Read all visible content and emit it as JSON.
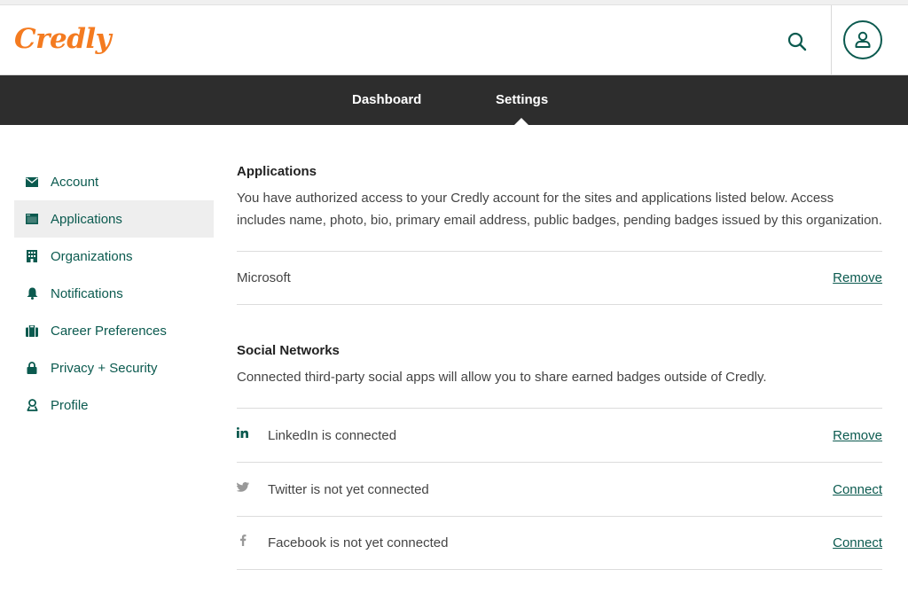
{
  "header": {
    "logo": "Credly",
    "search_icon": "search-icon",
    "avatar_icon": "user-icon"
  },
  "nav": {
    "dashboard": "Dashboard",
    "settings": "Settings"
  },
  "sidebar": {
    "items": [
      {
        "label": "Account",
        "icon": "envelope-icon"
      },
      {
        "label": "Applications",
        "icon": "browser-window-icon"
      },
      {
        "label": "Organizations",
        "icon": "building-icon"
      },
      {
        "label": "Notifications",
        "icon": "bell-icon"
      },
      {
        "label": "Career Preferences",
        "icon": "briefcase-icon"
      },
      {
        "label": "Privacy + Security",
        "icon": "lock-icon"
      },
      {
        "label": "Profile",
        "icon": "badge-person-icon"
      }
    ]
  },
  "applications": {
    "title": "Applications",
    "description": "You have authorized access to your Credly account for the sites and applications listed below. Access includes name, photo, bio, primary email address, public badges, pending badges issued by this organization.",
    "items": [
      {
        "name": "Microsoft",
        "action": "Remove"
      }
    ]
  },
  "social": {
    "title": "Social Networks",
    "description": "Connected third-party social apps will allow you to share earned badges outside of Credly.",
    "items": [
      {
        "label": "LinkedIn is connected",
        "action": "Remove",
        "icon": "linkedin-icon"
      },
      {
        "label": "Twitter is not yet connected",
        "action": "Connect",
        "icon": "twitter-icon"
      },
      {
        "label": "Facebook is not yet connected",
        "action": "Connect",
        "icon": "facebook-icon"
      }
    ]
  },
  "colors": {
    "brand_orange": "#f47b20",
    "accent_green": "#0b5a4f",
    "navbar": "#2d2d2d"
  }
}
